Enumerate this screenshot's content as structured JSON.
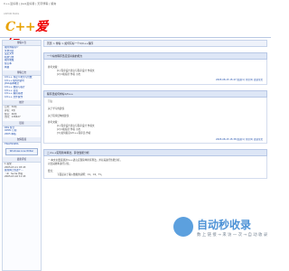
{
  "topnav": "C++爱好者 | Java爱好者 | 天宇博客 | 留言",
  "logo": {
    "sub": "ASHOR BLOG",
    "main": "C++",
    "main_cn": "爱好"
  },
  "sidebar": {
    "heading_1": "博客公告",
    "items_1": [
      "我的博客简介",
      "文章列表",
      "设定文件",
      "相册分类",
      "我的收藏",
      "留言本",
      "网摘"
    ],
    "heading_2": "博客日志",
    "items_2": [
      "C/C++ 预定义类型与位数",
      "C/C++常用的语句",
      "JAVA基本概念",
      "C/C++ 数组与指针",
      "C/C++ 链表",
      "C/C++ 编程基础",
      "C/C++ 文件操作"
    ],
    "heading_3": "统计",
    "stats": [
      "日志：53条",
      "评论：2条",
      "留言：46条",
      "访问：136427"
    ],
    "heading_4": "链接",
    "links": [
      "RSS 聚合",
      "OPML 订阅",
      "2005 本站"
    ],
    "heading_5": "友情链接",
    "links2": [
      "TRAVISSIMA"
    ],
    "cal_btn": "Windows Live Writer",
    "heading_6": "最新评论",
    "comments": [
      "1 提交",
      "2005-03-11 03:43",
      "我在网上找这个…",
      "（2）ha-ha 作者",
      "2005-03-16 11:43"
    ]
  },
  "content": {
    "crumb": "首页 > 博客 > 如何写好一个C/C++程序",
    "posts": [
      {
        "title": "一个好的程序员应该具备的能力",
        "lines": [
          "",
          "参考文献：",
          "[1] 程序设计语言与程序设计  作者文",
          "[2] C和指针  作者 小杰"
        ],
        "meta": "2005-08-15 15:47 阅读(1) 评论(0) 阅读全文"
      },
      {
        "title": "程序员如何学好C/C++",
        "lines": [
          "引言",
          "",
          "关于学习的建议",
          "",
          "关于程序结构的建议",
          "",
          "参考文献：",
          "[1] 程序设计语言与程序设计  作者文",
          "[2] C和指针  作者 小杰",
          "[3] 如何提高C/C++程序员  作者"
        ],
        "meta": "2005-08-15 15:38 阅读(1) 评论(0) 阅读全文"
      },
      {
        "title": "二.C++实现简单算法，算法性能分析",
        "lines": [
          "一.本文主要是通过C++语言实现简单排序算法，并对其进行性能分析，",
          "对比其效率进行讨论。",
          "",
          "",
          "要点：",
          "下面是关于输入数据的说明：C1，C2，T1。"
        ],
        "meta": ""
      }
    ]
  },
  "watermark": {
    "big": "自动秒收录",
    "small": "数 上 链 接 → 来 访 一 次 → 自 动 收 录"
  }
}
